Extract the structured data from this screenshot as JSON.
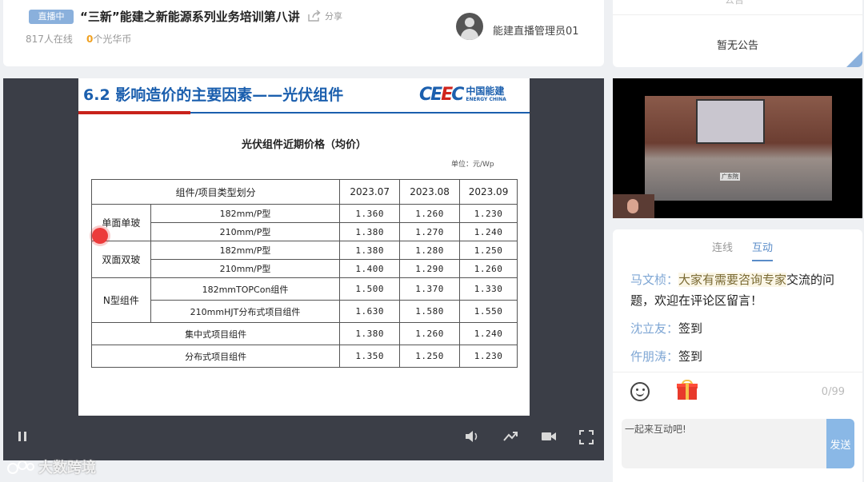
{
  "header": {
    "live_badge": "直播中",
    "title": "“三新”能建之新能源系列业务培训第八讲",
    "share_label": "分享",
    "online": "817人在线",
    "coins_num": "0",
    "coins_label": "个光华币",
    "host_name": "能建直播管理员01"
  },
  "notice": {
    "tab": "公告",
    "text": "暂无公告"
  },
  "slide": {
    "title": "6.2 影响造价的主要因素——光伏组件",
    "logo_mark": "CEEC",
    "logo_cn": "中国能建",
    "logo_en": "ENERGY CHINA",
    "table_title": "光伏组件近期价格（均价）",
    "unit": "单位：元/Wp",
    "table": {
      "header": [
        "组件/项目类型划分",
        "2023.07",
        "2023.08",
        "2023.09"
      ],
      "groups": [
        {
          "name": "单面单玻",
          "rows": [
            {
              "type": "182mm/P型",
              "values": [
                "1.360",
                "1.260",
                "1.230"
              ]
            },
            {
              "type": "210mm/P型",
              "values": [
                "1.380",
                "1.270",
                "1.240"
              ]
            }
          ]
        },
        {
          "name": "双面双玻",
          "rows": [
            {
              "type": "182mm/P型",
              "values": [
                "1.380",
                "1.280",
                "1.250"
              ]
            },
            {
              "type": "210mm/P型",
              "values": [
                "1.400",
                "1.290",
                "1.260"
              ]
            }
          ]
        },
        {
          "name": "N型组件",
          "rows": [
            {
              "type": "182mmTOPCon组件",
              "values": [
                "1.500",
                "1.370",
                "1.330"
              ]
            },
            {
              "type": "210mmHJT分布式项目组件",
              "values": [
                "1.630",
                "1.580",
                "1.550"
              ]
            }
          ]
        }
      ],
      "footer_rows": [
        {
          "label": "集中式项目组件",
          "values": [
            "1.380",
            "1.260",
            "1.240"
          ]
        },
        {
          "label": "分布式项目组件",
          "values": [
            "1.350",
            "1.250",
            "1.230"
          ]
        }
      ]
    }
  },
  "camera": {
    "caption": "广东院"
  },
  "chat": {
    "tabs": [
      "连线",
      "互动"
    ],
    "active_tab": "互动",
    "messages": [
      {
        "user": "马文桢：",
        "highlight": "大家有需要咨询专家",
        "text": "交流的问题，欢迎在评论区留言！"
      },
      {
        "user": "沈立友：",
        "highlight": "",
        "text": "签到"
      },
      {
        "user": "仵朋涛：",
        "highlight": "",
        "text": "签到"
      }
    ],
    "char_count": "0/99",
    "input_placeholder": "一起来互动吧!",
    "send_label": "发送"
  },
  "watermark": "大数跨境",
  "colors": {
    "accent": "#8ab0dc",
    "slide_blue": "#1b5fae",
    "slide_red": "#c8221b",
    "user_name": "#7ea6d4",
    "coin": "#f0a020"
  }
}
